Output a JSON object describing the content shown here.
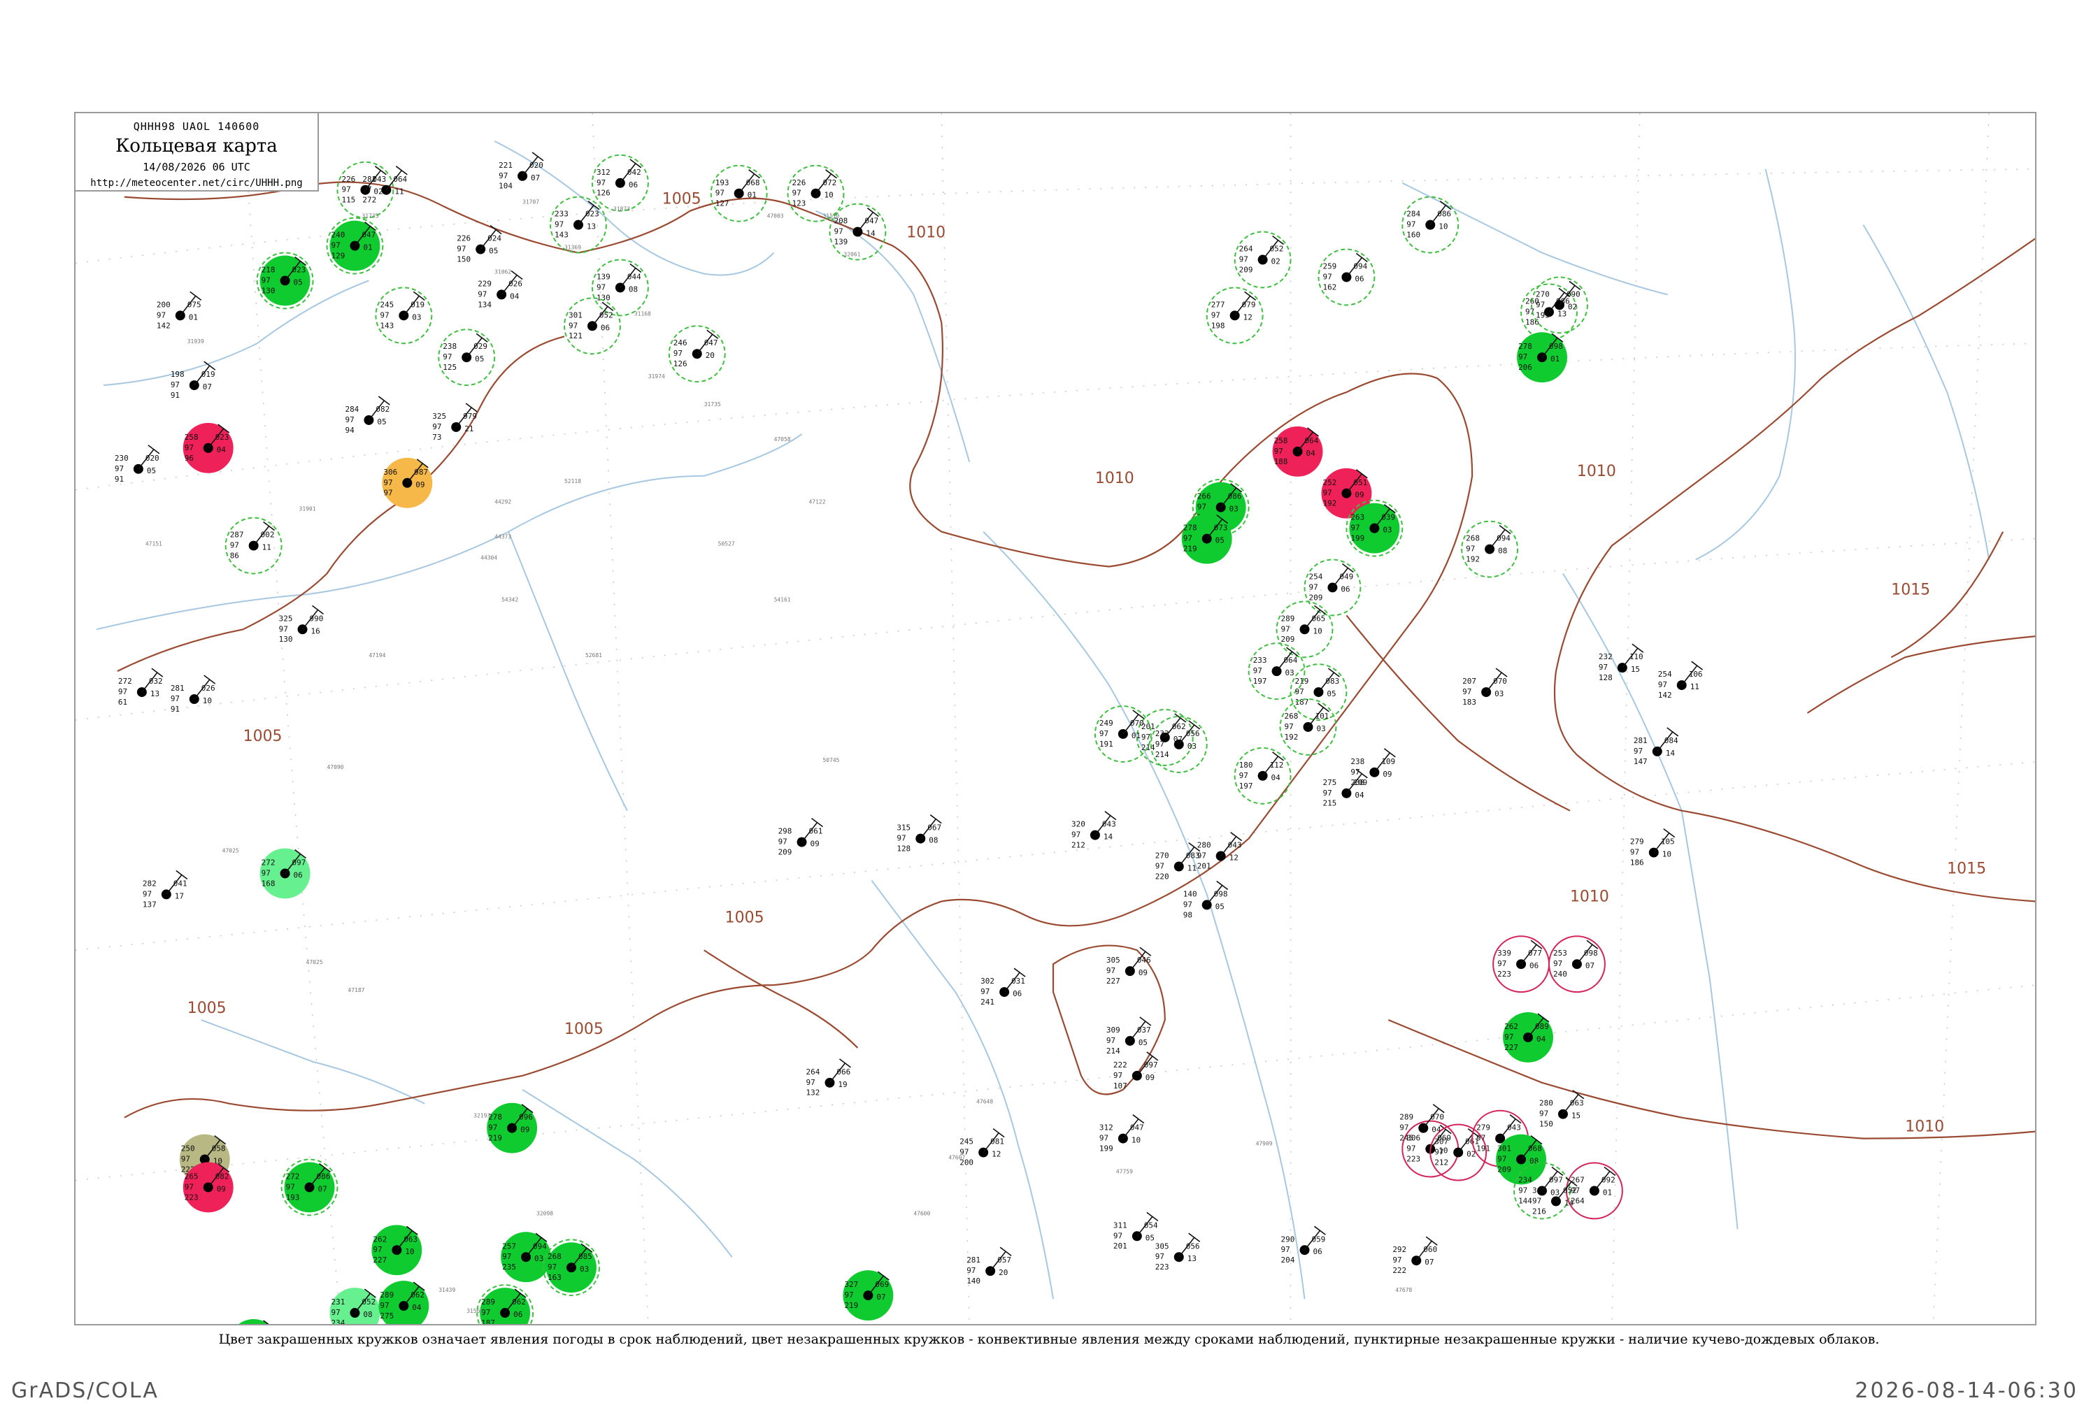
{
  "header": {
    "code": "QHHH98  UAOL  140600",
    "title": "Кольцевая карта",
    "datetime": "14/08/2026 06 UTC",
    "url": "http://meteocenter.net/circ/UHHH.png"
  },
  "caption": "Цвет закрашенных кружков означает явления погоды в срок наблюдений, цвет незакрашенных кружков - конвективные явления между сроками наблюдений, пунктирные незакрашенные кружки - наличие кучево-дождевых облаков.",
  "footer": {
    "left": "GrADS/COLA",
    "right": "2026-08-14-06:30"
  },
  "colors": {
    "isobar": "#9b4a32",
    "river": "#a7c8e0",
    "rain_fill": "#0fcb2f",
    "thunder_fill": "#ee2258",
    "fog_fill": "#f7b84a",
    "shower_light_fill": "#66f08f",
    "dust_fill": "#b8b884",
    "cb_dashed": "#3fbf3f",
    "thunder_ring": "#d4245a"
  },
  "isobar_labels": [
    "1005",
    "1005",
    "1005",
    "1005",
    "1005",
    "1010",
    "1010",
    "1010",
    "1010",
    "1010",
    "1015",
    "1015"
  ],
  "stations": [
    {
      "t": "226",
      "d": "043",
      "p": "115",
      "dp": "02",
      "fill": "none",
      "ring": "cb"
    },
    {
      "t": "221",
      "d": "020",
      "p": "104",
      "dp": "07",
      "fill": "none",
      "ring": "none"
    },
    {
      "t": "312",
      "d": "042",
      "p": "126",
      "dp": "06",
      "fill": "none",
      "ring": "cb"
    },
    {
      "t": "193",
      "d": "068",
      "p": "127",
      "dp": "01",
      "fill": "none",
      "ring": "cb"
    },
    {
      "t": "226",
      "d": "072",
      "p": "123",
      "dp": "10",
      "fill": "none",
      "ring": "cb"
    },
    {
      "t": "208",
      "d": "047",
      "p": "139",
      "dp": "14",
      "fill": "none",
      "ring": "cb"
    },
    {
      "t": "233",
      "d": "023",
      "p": "143",
      "dp": "13",
      "fill": "none",
      "ring": "cb"
    },
    {
      "t": "139",
      "d": "044",
      "p": "130",
      "dp": "08",
      "fill": "none",
      "ring": "cb"
    },
    {
      "t": "226",
      "d": "024",
      "p": "150",
      "dp": "05",
      "fill": "none",
      "ring": "none"
    },
    {
      "t": "200",
      "d": "075",
      "p": "142",
      "dp": "01",
      "fill": "none",
      "ring": "none"
    },
    {
      "t": "218",
      "d": "023",
      "p": "130",
      "dp": "05",
      "fill": "rain",
      "ring": "cb"
    },
    {
      "t": "240",
      "d": "047",
      "p": "129",
      "dp": "01",
      "fill": "rain",
      "ring": "cb"
    },
    {
      "t": "245",
      "d": "019",
      "p": "143",
      "dp": "03",
      "fill": "none",
      "ring": "cb"
    },
    {
      "t": "229",
      "d": "026",
      "p": "134",
      "dp": "04",
      "fill": "none",
      "ring": "none"
    },
    {
      "t": "238",
      "d": "029",
      "p": "125",
      "dp": "05",
      "fill": "none",
      "ring": "cb"
    },
    {
      "t": "301",
      "d": "052",
      "p": "121",
      "dp": "06",
      "fill": "none",
      "ring": "cb"
    },
    {
      "t": "246",
      "d": "047",
      "p": "126",
      "dp": "20",
      "fill": "none",
      "ring": "cb"
    },
    {
      "t": "198",
      "d": "019",
      "p": "91",
      "dp": "07",
      "fill": "none",
      "ring": "none"
    },
    {
      "t": "258",
      "d": "023",
      "p": "96",
      "dp": "04",
      "fill": "thunder",
      "ring": "none"
    },
    {
      "t": "230",
      "d": "020",
      "p": "91",
      "dp": "05",
      "fill": "none",
      "ring": "none"
    },
    {
      "t": "306",
      "d": "987",
      "p": "97",
      "dp": "09",
      "fill": "fog",
      "ring": "none"
    },
    {
      "t": "287",
      "d": "002",
      "p": "86",
      "dp": "11",
      "fill": "none",
      "ring": "cb"
    },
    {
      "t": "284",
      "d": "082",
      "p": "94",
      "dp": "05",
      "fill": "none",
      "ring": "none"
    },
    {
      "t": "325",
      "d": "979",
      "p": "73",
      "dp": "21",
      "fill": "none",
      "ring": "none"
    },
    {
      "t": "325",
      "d": "990",
      "p": "130",
      "dp": "16",
      "fill": "none",
      "ring": "none"
    },
    {
      "t": "272",
      "d": "032",
      "p": "61",
      "dp": "13",
      "fill": "none",
      "ring": "none"
    },
    {
      "t": "281",
      "d": "026",
      "p": "91",
      "dp": "10",
      "fill": "none",
      "ring": "none"
    },
    {
      "t": "272",
      "d": "097",
      "p": "168",
      "dp": "06",
      "fill": "shower_light",
      "ring": "none"
    },
    {
      "t": "282",
      "d": "041",
      "p": "137",
      "dp": "17",
      "fill": "none",
      "ring": "none"
    },
    {
      "t": "250",
      "d": "058",
      "p": "222",
      "dp": "10",
      "fill": "dust",
      "ring": "none"
    },
    {
      "t": "231",
      "d": "052",
      "p": "234",
      "dp": "08",
      "fill": "shower_light",
      "ring": "none"
    },
    {
      "t": "289",
      "d": "062",
      "p": "275",
      "dp": "04",
      "fill": "rain",
      "ring": "none"
    },
    {
      "t": "279",
      "d": "066",
      "p": "224",
      "dp": "11",
      "fill": "rain",
      "ring": "none"
    },
    {
      "t": "265",
      "d": "082",
      "p": "223",
      "dp": "09",
      "fill": "thunder",
      "ring": "none"
    },
    {
      "t": "262",
      "d": "063",
      "p": "227",
      "dp": "10",
      "fill": "rain",
      "ring": "none"
    },
    {
      "t": "289",
      "d": "062",
      "p": "187",
      "dp": "06",
      "fill": "rain",
      "ring": "cb"
    },
    {
      "t": "272",
      "d": "086",
      "p": "193",
      "dp": "07",
      "fill": "rain",
      "ring": "cb"
    },
    {
      "t": "278",
      "d": "096",
      "p": "219",
      "dp": "09",
      "fill": "rain",
      "ring": "none"
    },
    {
      "t": "257",
      "d": "094",
      "p": "235",
      "dp": "03",
      "fill": "rain",
      "ring": "none"
    },
    {
      "t": "268",
      "d": "085",
      "p": "163",
      "dp": "03",
      "fill": "rain",
      "ring": "cb"
    },
    {
      "t": "306",
      "d": "069",
      "p": "223",
      "dp": "10",
      "fill": "none",
      "ring": "thunder"
    },
    {
      "t": "307",
      "d": "061",
      "p": "212",
      "dp": "02",
      "fill": "none",
      "ring": "thunder"
    },
    {
      "t": "279",
      "d": "043",
      "p": "191",
      "dp": "15",
      "fill": "none",
      "ring": "thunder"
    },
    {
      "t": "301",
      "d": "068",
      "p": "209",
      "dp": "08",
      "fill": "rain",
      "ring": "none"
    },
    {
      "t": "234",
      "d": "097",
      "p": "144",
      "dp": "03",
      "fill": "none",
      "ring": "cb"
    },
    {
      "t": "267",
      "d": "092",
      "p": "264",
      "dp": "01",
      "fill": "none",
      "ring": "thunder"
    },
    {
      "t": "339",
      "d": "077",
      "p": "223",
      "dp": "06",
      "fill": "none",
      "ring": "thunder"
    },
    {
      "t": "253",
      "d": "098",
      "p": "240",
      "dp": "07",
      "fill": "none",
      "ring": "thunder"
    },
    {
      "t": "262",
      "d": "089",
      "p": "227",
      "dp": "04",
      "fill": "rain",
      "ring": "none"
    },
    {
      "t": "327",
      "d": "069",
      "p": "219",
      "dp": "07",
      "fill": "rain",
      "ring": "none"
    },
    {
      "t": "258",
      "d": "064",
      "p": "188",
      "dp": "04",
      "fill": "thunder",
      "ring": "none"
    },
    {
      "t": "252",
      "d": "051",
      "p": "192",
      "dp": "09",
      "fill": "thunder",
      "ring": "none"
    },
    {
      "t": "263",
      "d": "039",
      "p": "199",
      "dp": "03",
      "fill": "rain",
      "ring": "cb"
    },
    {
      "t": "254",
      "d": "049",
      "p": "209",
      "dp": "06",
      "fill": "none",
      "ring": "cb"
    },
    {
      "t": "289",
      "d": "065",
      "p": "209",
      "dp": "10",
      "fill": "none",
      "ring": "cb"
    },
    {
      "t": "233",
      "d": "064",
      "p": "197",
      "dp": "03",
      "fill": "none",
      "ring": "cb"
    },
    {
      "t": "219",
      "d": "083",
      "p": "187",
      "dp": "05",
      "fill": "none",
      "ring": "cb"
    },
    {
      "t": "268",
      "d": "101",
      "p": "192",
      "dp": "03",
      "fill": "none",
      "ring": "cb"
    },
    {
      "t": "180",
      "d": "112",
      "p": "197",
      "dp": "04",
      "fill": "none",
      "ring": "cb"
    },
    {
      "t": "201",
      "d": "062",
      "p": "214",
      "dp": "07",
      "fill": "none",
      "ring": "cb"
    },
    {
      "t": "249",
      "d": "070",
      "p": "191",
      "dp": "01",
      "fill": "none",
      "ring": "cb"
    },
    {
      "t": "264",
      "d": "052",
      "p": "209",
      "dp": "02",
      "fill": "none",
      "ring": "cb"
    },
    {
      "t": "277",
      "d": "079",
      "p": "198",
      "dp": "12",
      "fill": "none",
      "ring": "cb"
    },
    {
      "t": "259",
      "d": "094",
      "p": "162",
      "dp": "06",
      "fill": "none",
      "ring": "cb"
    },
    {
      "t": "284",
      "d": "086",
      "p": "160",
      "dp": "10",
      "fill": "none",
      "ring": "cb"
    },
    {
      "t": "260",
      "d": "086",
      "p": "186",
      "dp": "13",
      "fill": "none",
      "ring": "cb"
    },
    {
      "t": "270",
      "d": "090",
      "p": "193",
      "dp": "02",
      "fill": "none",
      "ring": "cb"
    },
    {
      "t": "268",
      "d": "094",
      "p": "192",
      "dp": "08",
      "fill": "none",
      "ring": "cb"
    },
    {
      "t": "278",
      "d": "098",
      "p": "206",
      "dp": "01",
      "fill": "rain",
      "ring": "none"
    },
    {
      "t": "266",
      "d": "086",
      "p": "222",
      "dp": "03",
      "fill": "rain",
      "ring": "cb"
    },
    {
      "t": "278",
      "d": "073",
      "p": "219",
      "dp": "05",
      "fill": "rain",
      "ring": "none"
    },
    {
      "t": "233",
      "d": "056",
      "p": "214",
      "dp": "03",
      "fill": "none",
      "ring": "cb"
    },
    {
      "t": "280",
      "d": "043",
      "p": "201",
      "dp": "12",
      "fill": "none",
      "ring": "none"
    },
    {
      "t": "270",
      "d": "083",
      "p": "220",
      "dp": "11",
      "fill": "none",
      "ring": "none"
    },
    {
      "t": "140",
      "d": "098",
      "p": "98",
      "dp": "05",
      "fill": "none",
      "ring": "none"
    },
    {
      "t": "275",
      "d": "109",
      "p": "215",
      "dp": "04",
      "fill": "none",
      "ring": "none"
    },
    {
      "t": "238",
      "d": "109",
      "p": "238",
      "dp": "09",
      "fill": "none",
      "ring": "none"
    },
    {
      "t": "222",
      "d": "097",
      "p": "107",
      "dp": "09",
      "fill": "none",
      "ring": "none"
    },
    {
      "t": "207",
      "d": "070",
      "p": "183",
      "dp": "03",
      "fill": "none",
      "ring": "none"
    },
    {
      "t": "232",
      "d": "110",
      "p": "128",
      "dp": "15",
      "fill": "none",
      "ring": "none"
    },
    {
      "t": "254",
      "d": "106",
      "p": "142",
      "dp": "11",
      "fill": "none",
      "ring": "none"
    },
    {
      "t": "279",
      "d": "105",
      "p": "186",
      "dp": "10",
      "fill": "none",
      "ring": "none"
    },
    {
      "t": "281",
      "d": "084",
      "p": "147",
      "dp": "14",
      "fill": "none",
      "ring": "none"
    },
    {
      "t": "280",
      "d": "063",
      "p": "150",
      "dp": "15",
      "fill": "none",
      "ring": "none"
    },
    {
      "t": "245",
      "d": "081",
      "p": "200",
      "dp": "12",
      "fill": "none",
      "ring": "none"
    },
    {
      "t": "281",
      "d": "057",
      "p": "140",
      "dp": "20",
      "fill": "none",
      "ring": "none"
    },
    {
      "t": "264",
      "d": "066",
      "p": "132",
      "dp": "19",
      "fill": "none",
      "ring": "none"
    },
    {
      "t": "298",
      "d": "061",
      "p": "209",
      "dp": "09",
      "fill": "none",
      "ring": "none"
    },
    {
      "t": "315",
      "d": "067",
      "p": "128",
      "dp": "08",
      "fill": "none",
      "ring": "none"
    },
    {
      "t": "320",
      "d": "043",
      "p": "212",
      "dp": "14",
      "fill": "none",
      "ring": "none"
    },
    {
      "t": "305",
      "d": "046",
      "p": "227",
      "dp": "09",
      "fill": "none",
      "ring": "none"
    },
    {
      "t": "302",
      "d": "031",
      "p": "241",
      "dp": "06",
      "fill": "none",
      "ring": "none"
    },
    {
      "t": "309",
      "d": "037",
      "p": "214",
      "dp": "05",
      "fill": "none",
      "ring": "none"
    },
    {
      "t": "312",
      "d": "047",
      "p": "199",
      "dp": "10",
      "fill": "none",
      "ring": "none"
    },
    {
      "t": "311",
      "d": "054",
      "p": "201",
      "dp": "05",
      "fill": "none",
      "ring": "none"
    },
    {
      "t": "305",
      "d": "056",
      "p": "223",
      "dp": "13",
      "fill": "none",
      "ring": "none"
    },
    {
      "t": "290",
      "d": "059",
      "p": "204",
      "dp": "06",
      "fill": "none",
      "ring": "none"
    },
    {
      "t": "292",
      "d": "060",
      "p": "222",
      "dp": "07",
      "fill": "none",
      "ring": "none"
    },
    {
      "t": "345",
      "d": "052",
      "p": "216",
      "dp": "14",
      "fill": "none",
      "ring": "none"
    },
    {
      "t": "289",
      "d": "070",
      "p": "245",
      "dp": "04",
      "fill": "none",
      "ring": "none"
    },
    {
      "t": "317",
      "d": "064",
      "p": "213",
      "dp": "01",
      "fill": "none",
      "ring": "none"
    },
    {
      "t": "281",
      "d": "064",
      "p": "272",
      "dp": "11",
      "fill": "none",
      "ring": "none"
    }
  ],
  "station_indices": [
    "31735",
    "31707",
    "31873",
    "47003",
    "31510",
    "32061",
    "31369",
    "31168",
    "31062",
    "31939",
    "31974",
    "31735",
    "47058",
    "47122",
    "54161",
    "50745",
    "50527",
    "52681",
    "52118",
    "54342",
    "44292",
    "44373",
    "44304",
    "31901",
    "47194",
    "47151",
    "47090",
    "47025",
    "47025",
    "47187",
    "32193",
    "32098",
    "31439",
    "31561",
    "47600",
    "47607",
    "47648",
    "47759",
    "47909",
    "47678"
  ]
}
